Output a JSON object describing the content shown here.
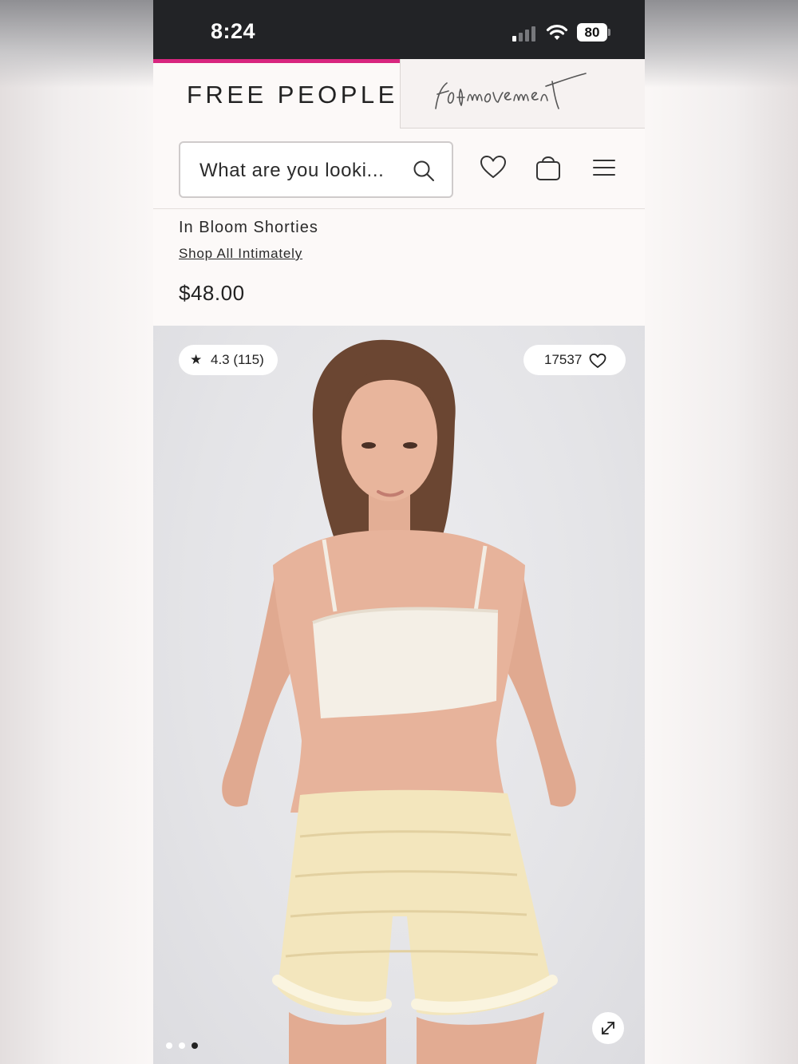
{
  "status_bar": {
    "time": "8:24",
    "battery": "80"
  },
  "brands": {
    "free_people": "FREE PEOPLE",
    "fp_movement": "fp movement"
  },
  "search": {
    "placeholder": "What are you looki..."
  },
  "header_icons": [
    "heart-icon",
    "bag-icon",
    "menu-icon"
  ],
  "product": {
    "name": "In Bloom Shorties",
    "shop_link": "Shop All Intimately",
    "price": "$48.00",
    "rating_star": "★",
    "rating": "4.3 (115)",
    "likes": "17537",
    "image_count": 3,
    "active_image": 3
  },
  "colors": {
    "accent": "#d8267f",
    "status_bar": "#222326",
    "page_bg": "#fcf9f8"
  }
}
